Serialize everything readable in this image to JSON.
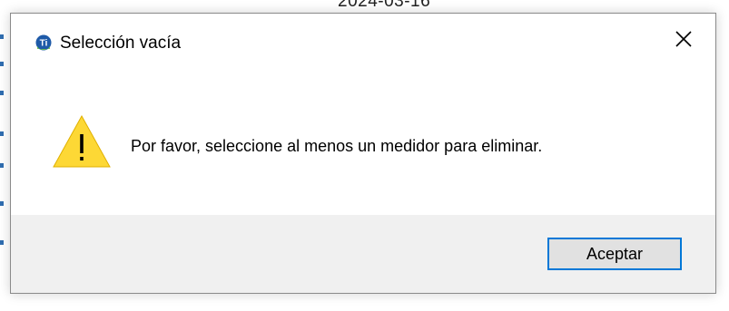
{
  "background": {
    "partial_text": "2024-03-16"
  },
  "dialog": {
    "title": "Selección vacía",
    "app_icon": "app-logo-icon",
    "close_icon": "close-icon",
    "warning_icon": "warning-icon",
    "message": "Por favor, seleccione al menos un medidor para eliminar.",
    "ok_label": "Aceptar"
  },
  "colors": {
    "accent": "#0078d7",
    "warning": "#fdd835",
    "footer_bg": "#f0f0f0"
  }
}
